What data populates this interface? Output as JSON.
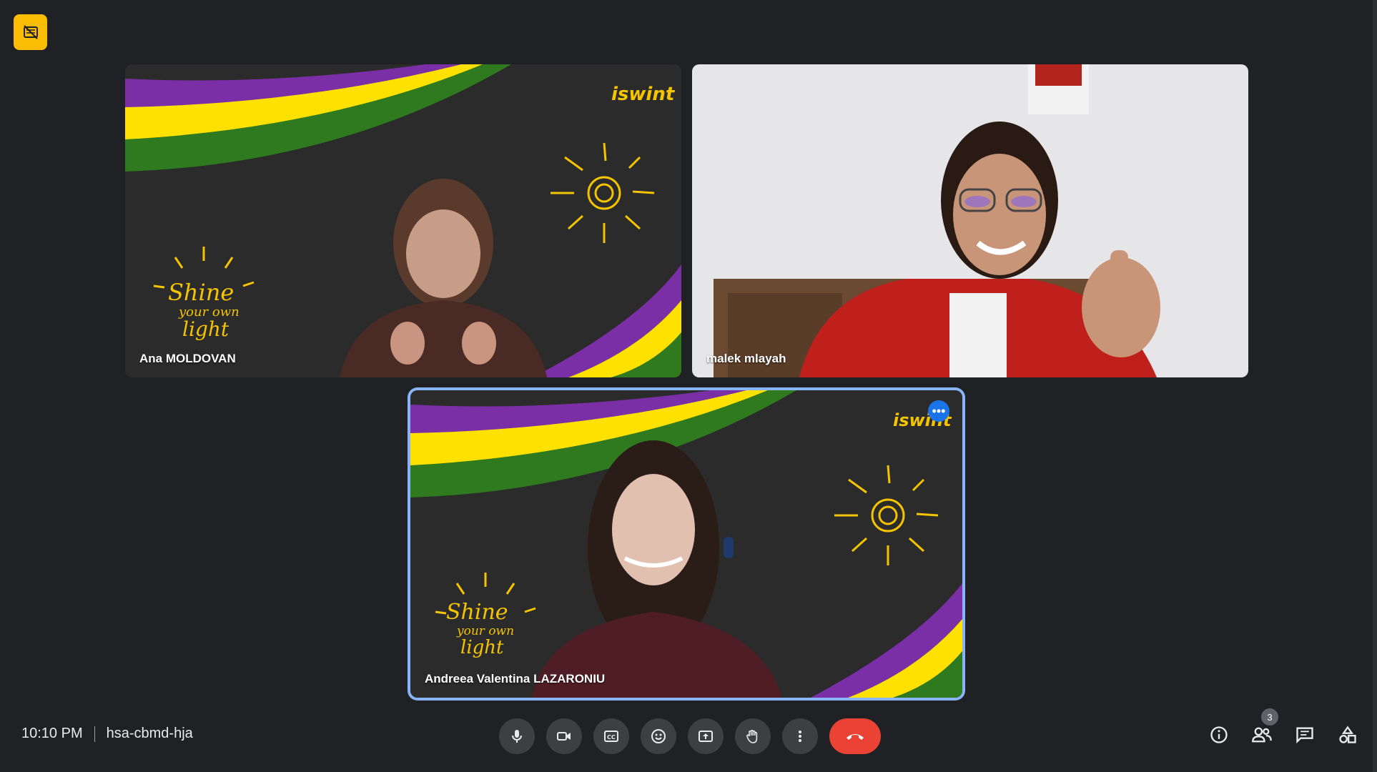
{
  "meeting": {
    "time": "10:10 PM",
    "code": "hsa-cbmd-hja"
  },
  "participants": [
    {
      "name": "Ana MOLDOVAN",
      "background": "chalkboard-shine"
    },
    {
      "name": "malek mlayah",
      "background": "camera-room"
    },
    {
      "name": "Andreea Valentina LAZARONIU",
      "background": "chalkboard-shine",
      "active_speaker": true
    }
  ],
  "people_count": "3",
  "tile_menu_glyph": "•••",
  "controls": [
    {
      "id": "mic",
      "icon": "microphone-icon"
    },
    {
      "id": "camera",
      "icon": "video-camera-icon"
    },
    {
      "id": "captions",
      "icon": "closed-captions-icon"
    },
    {
      "id": "reactions",
      "icon": "emoji-icon"
    },
    {
      "id": "present",
      "icon": "present-screen-icon"
    },
    {
      "id": "raise-hand",
      "icon": "hand-icon"
    },
    {
      "id": "more",
      "icon": "more-vert-icon"
    },
    {
      "id": "leave",
      "icon": "end-call-icon"
    }
  ],
  "right_panel": [
    {
      "id": "info",
      "icon": "info-icon"
    },
    {
      "id": "people",
      "icon": "people-icon"
    },
    {
      "id": "chat",
      "icon": "chat-icon"
    },
    {
      "id": "activities",
      "icon": "activities-icon"
    }
  ],
  "colors": {
    "background": "#202124",
    "accent": "#8ab4f8",
    "end_call": "#ea4335",
    "badge": "#fbbc04",
    "stripe_purple": "#7b2fa6",
    "stripe_yellow": "#ffe100",
    "stripe_green": "#2f7a1f"
  },
  "background_text": {
    "logo": "iswint",
    "shine_line1": "Shine",
    "shine_line2": "your own",
    "shine_line3": "light"
  }
}
